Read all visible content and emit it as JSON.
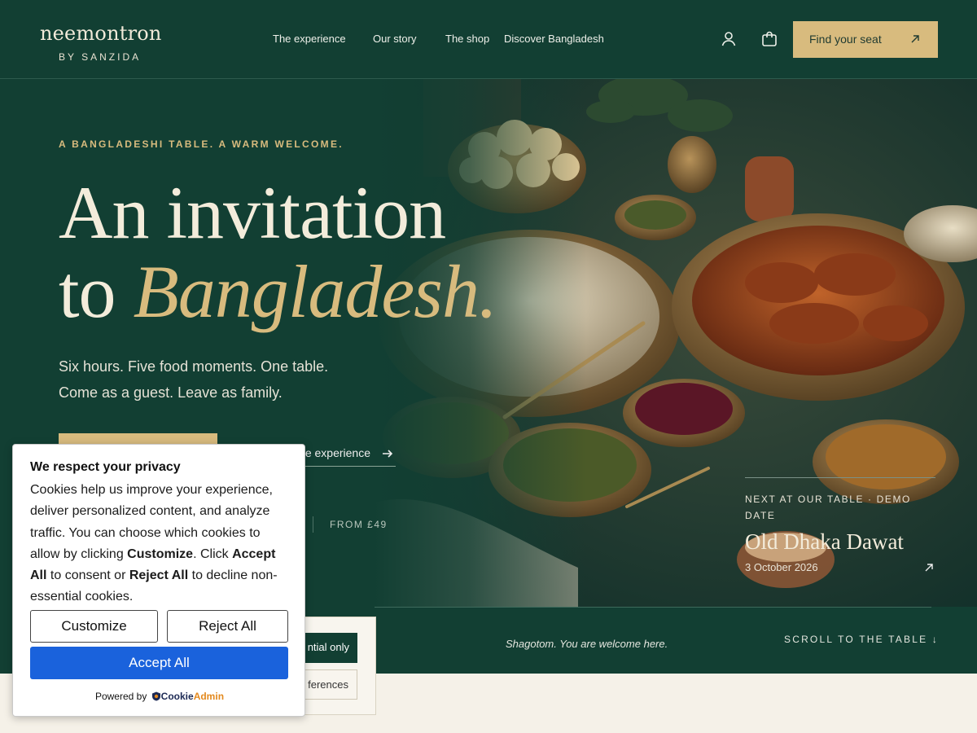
{
  "header": {
    "logo_main": "neemontron",
    "logo_sub": "BY SANZIDA",
    "nav": [
      "The experience",
      "Our story",
      "The shop",
      "Discover Bangladesh"
    ],
    "cta": "Find your seat"
  },
  "hero": {
    "kicker": "A BANGLADESHI TABLE. A WARM WELCOME.",
    "title_line1": "An invitation",
    "title_line2_prefix": "to",
    "title_line2_em": "Bangladesh.",
    "lead_line1": "Six hours. Five food moments. One table.",
    "lead_line2": "Come as a guest. Leave as family.",
    "secondary_link": "e experience",
    "price": "FROM £49"
  },
  "next_event": {
    "label": "NEXT AT OUR TABLE · DEMO DATE",
    "title": "Old Dhaka Dawat",
    "date": "3 October 2026"
  },
  "strip": {
    "tagline": "Shagotom. You are welcome here.",
    "scroll": "SCROLL TO THE TABLE ↓"
  },
  "preferences_panel": {
    "essential": "ntial only",
    "preferences": "ferences"
  },
  "cookie": {
    "title": "We respect your privacy",
    "body_1": "Cookies help us improve your experience, deliver personalized content, and analyze traffic. You can choose which cookies to allow by clicking ",
    "customize_word": "Customize",
    "body_2": ". Click ",
    "accept_word": "Accept All",
    "body_3": " to consent or ",
    "reject_word": "Reject All",
    "body_4": " to decline non-essential cookies.",
    "customize_btn": "Customize",
    "reject_btn": "Reject All",
    "accept_btn": "Accept All",
    "powered_by": "Powered by",
    "brand_cookie": "Cookie",
    "brand_admin": "Admin"
  },
  "colors": {
    "hero_green": "#123f33",
    "gold": "#d8bb7e",
    "accept_blue": "#1a62dc"
  },
  "icons": [
    "user-icon",
    "shopping-bag-icon",
    "arrow-up-right-icon",
    "arrow-right-icon",
    "arrow-down-icon",
    "cookieadmin-logo-icon"
  ]
}
